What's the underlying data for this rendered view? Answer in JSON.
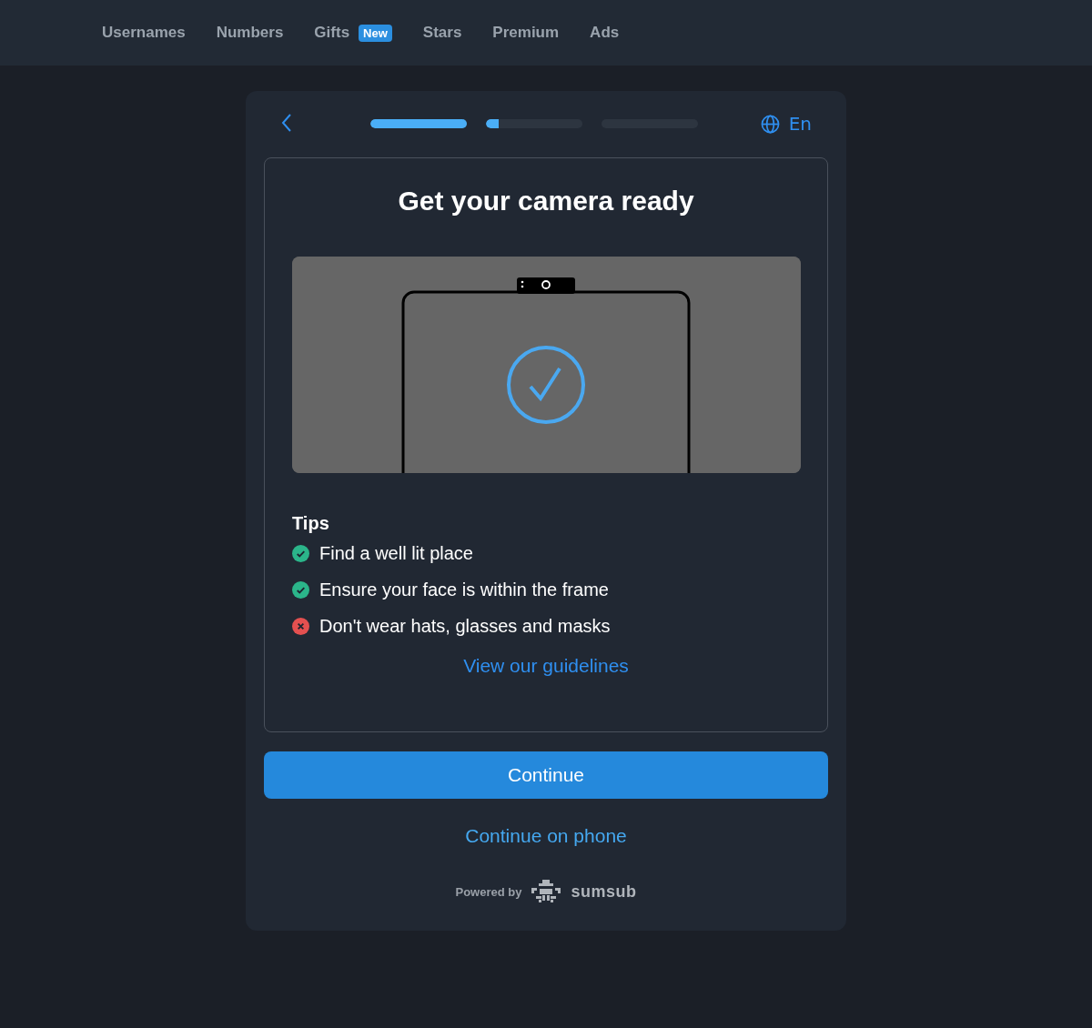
{
  "nav": {
    "items": [
      {
        "label": "Usernames"
      },
      {
        "label": "Numbers"
      },
      {
        "label": "Gifts",
        "badge": "New"
      },
      {
        "label": "Stars"
      },
      {
        "label": "Premium"
      },
      {
        "label": "Ads"
      }
    ]
  },
  "header": {
    "steps": [
      {
        "level": 1
      },
      {
        "level": 0.13
      },
      {
        "level": 0
      }
    ],
    "language": "En"
  },
  "title": "Get your camera ready",
  "tips": {
    "heading": "Tips",
    "items": [
      {
        "kind": "do",
        "text": "Find a well lit place"
      },
      {
        "kind": "do",
        "text": "Ensure your face is within the frame"
      },
      {
        "kind": "dont",
        "text": "Don't wear hats, glasses and masks"
      }
    ]
  },
  "guidelines_link": "View our guidelines",
  "continue_button": "Continue",
  "phone_link": "Continue on phone",
  "footer": {
    "powered_by": "Powered by",
    "brand": "sumsub"
  }
}
